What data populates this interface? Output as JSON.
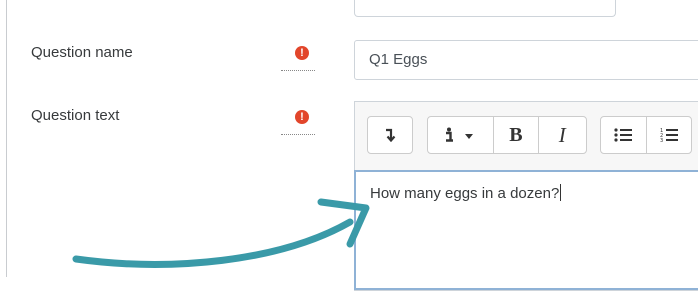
{
  "form": {
    "question_name": {
      "label": "Question name",
      "required_icon": "exclamation-circle-icon",
      "value": "Q1 Eggs"
    },
    "question_text": {
      "label": "Question text",
      "required_icon": "exclamation-circle-icon",
      "editor": {
        "toolbar": {
          "buttons": [
            {
              "name": "toggle-toolbar",
              "icon": "down-arrow-icon"
            },
            {
              "name": "info",
              "icon": "info-icon",
              "has_dropdown": true
            },
            {
              "name": "bold",
              "label": "B"
            },
            {
              "name": "italic",
              "label": "I"
            },
            {
              "name": "unordered-list",
              "icon": "bullet-list-icon"
            },
            {
              "name": "ordered-list",
              "icon": "numbered-list-icon"
            }
          ],
          "bold_label": "B",
          "italic_label": "I"
        },
        "content": "How many eggs in a dozen?"
      }
    }
  },
  "colors": {
    "required": "#e2462b",
    "annotation_arrow": "#3a9aa8",
    "focus_border": "#8fb2d6"
  }
}
